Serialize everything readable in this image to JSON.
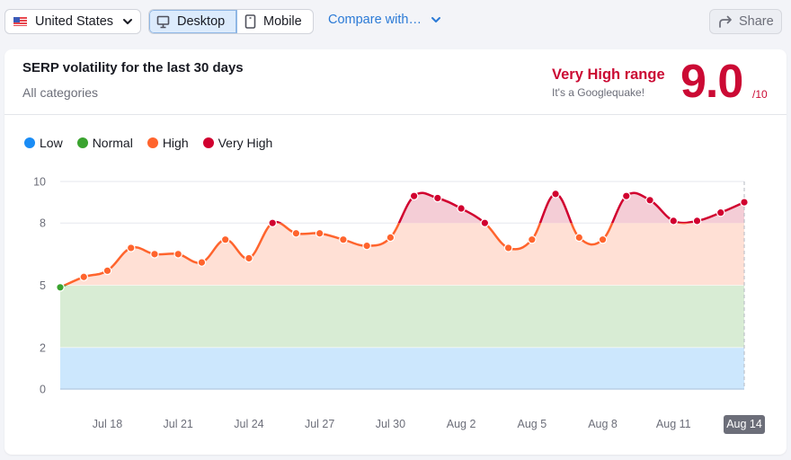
{
  "toolbar": {
    "country": {
      "label": "United States",
      "flag": "us-flag-icon"
    },
    "device_toggle": [
      {
        "label": "Desktop",
        "icon": "desktop-icon",
        "active": true
      },
      {
        "label": "Mobile",
        "icon": "mobile-icon",
        "active": false
      }
    ],
    "compare_label": "Compare with…",
    "share_label": "Share"
  },
  "card": {
    "title": "SERP volatility for the last 30 days",
    "subtitle": "All categories",
    "range_label": "Very High range",
    "range_sub": "It's a Googlequake!",
    "score": "9.0",
    "score_max": "/10"
  },
  "colors": {
    "low": "#1a8cf5",
    "normal": "#3aa32f",
    "high": "#ff642d",
    "very_high": "#d1002f",
    "accent_red": "#cb0a34",
    "link_blue": "#2b7ad6"
  },
  "chart_data": {
    "type": "line",
    "title": "SERP volatility for the last 30 days",
    "xlabel": "",
    "ylabel": "",
    "ylim": [
      0,
      10
    ],
    "yticks": [
      0,
      2,
      5,
      8,
      10
    ],
    "grid": true,
    "legend_position": "top-left",
    "legend": [
      {
        "name": "Low",
        "range": [
          0,
          2
        ],
        "color": "#1a8cf5",
        "band": "#cce7fd"
      },
      {
        "name": "Normal",
        "range": [
          2,
          5
        ],
        "color": "#3aa32f",
        "band": "#d8ecd4"
      },
      {
        "name": "High",
        "range": [
          5,
          8
        ],
        "color": "#ff642d",
        "band": "#ffe0d5"
      },
      {
        "name": "Very High",
        "range": [
          8,
          10
        ],
        "color": "#d1002f",
        "band": "#f4cdd6"
      }
    ],
    "x": [
      "Jul 16",
      "Jul 17",
      "Jul 18",
      "Jul 19",
      "Jul 20",
      "Jul 21",
      "Jul 22",
      "Jul 23",
      "Jul 24",
      "Jul 25",
      "Jul 26",
      "Jul 27",
      "Jul 28",
      "Jul 29",
      "Jul 30",
      "Jul 31",
      "Aug 1",
      "Aug 2",
      "Aug 3",
      "Aug 4",
      "Aug 5",
      "Aug 6",
      "Aug 7",
      "Aug 8",
      "Aug 9",
      "Aug 10",
      "Aug 11",
      "Aug 12",
      "Aug 13",
      "Aug 14"
    ],
    "values": [
      4.9,
      5.4,
      5.7,
      6.8,
      6.5,
      6.5,
      6.1,
      7.2,
      6.3,
      8.0,
      7.5,
      7.5,
      7.2,
      6.9,
      7.3,
      9.3,
      9.2,
      8.7,
      8.0,
      6.8,
      7.2,
      9.4,
      7.3,
      7.2,
      9.3,
      9.1,
      8.1,
      8.1,
      8.5,
      9.0
    ],
    "xtick_labels": [
      "Jul 18",
      "Jul 21",
      "Jul 24",
      "Jul 27",
      "Jul 30",
      "Aug 2",
      "Aug 5",
      "Aug 8",
      "Aug 11",
      "Aug 14"
    ],
    "highlighted_x": "Aug 14"
  }
}
